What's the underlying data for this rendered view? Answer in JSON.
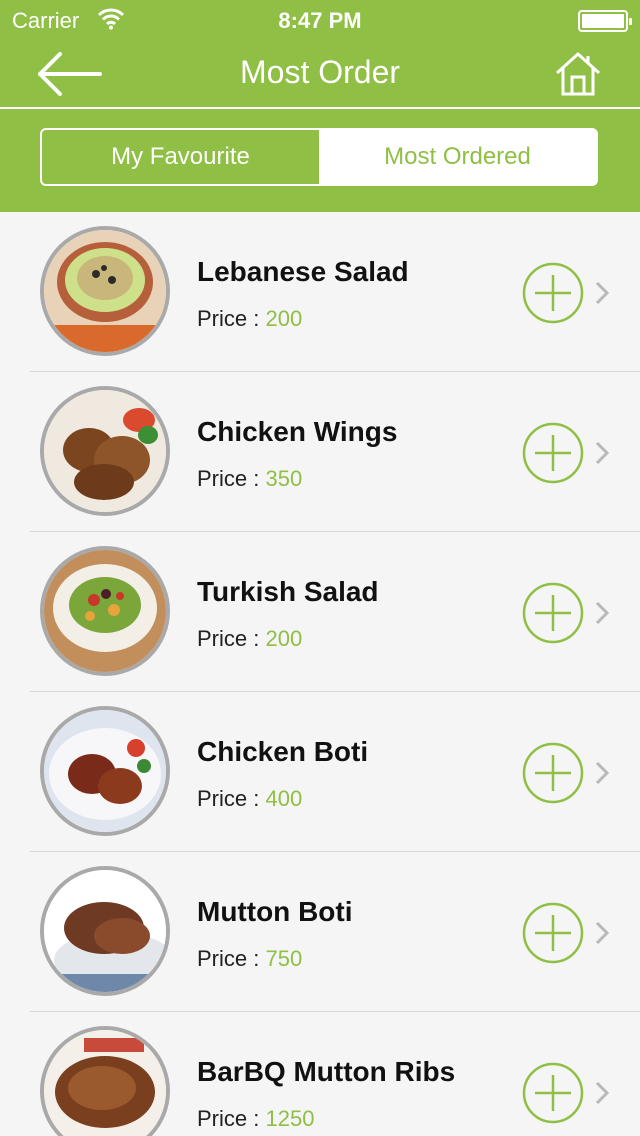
{
  "status_bar": {
    "carrier": "Carrier",
    "time": "8:47 PM"
  },
  "nav": {
    "title": "Most Order"
  },
  "tabs": [
    {
      "label": "My Favourite",
      "active": true
    },
    {
      "label": "Most Ordered",
      "active": false
    }
  ],
  "price_label": "Price :",
  "items": [
    {
      "name": "Lebanese Salad",
      "price": "200"
    },
    {
      "name": "Chicken Wings",
      "price": "350"
    },
    {
      "name": "Turkish Salad",
      "price": "200"
    },
    {
      "name": "Chicken Boti",
      "price": "400"
    },
    {
      "name": "Mutton Boti",
      "price": "750"
    },
    {
      "name": "BarBQ Mutton Ribs",
      "price": "1250"
    }
  ],
  "colors": {
    "accent": "#8fbf45",
    "background": "#f5f5f5"
  },
  "icons": {
    "back": "left-arrow-icon",
    "home": "home-icon",
    "add": "add-circle-icon",
    "disclosure": "chevron-right-icon"
  }
}
